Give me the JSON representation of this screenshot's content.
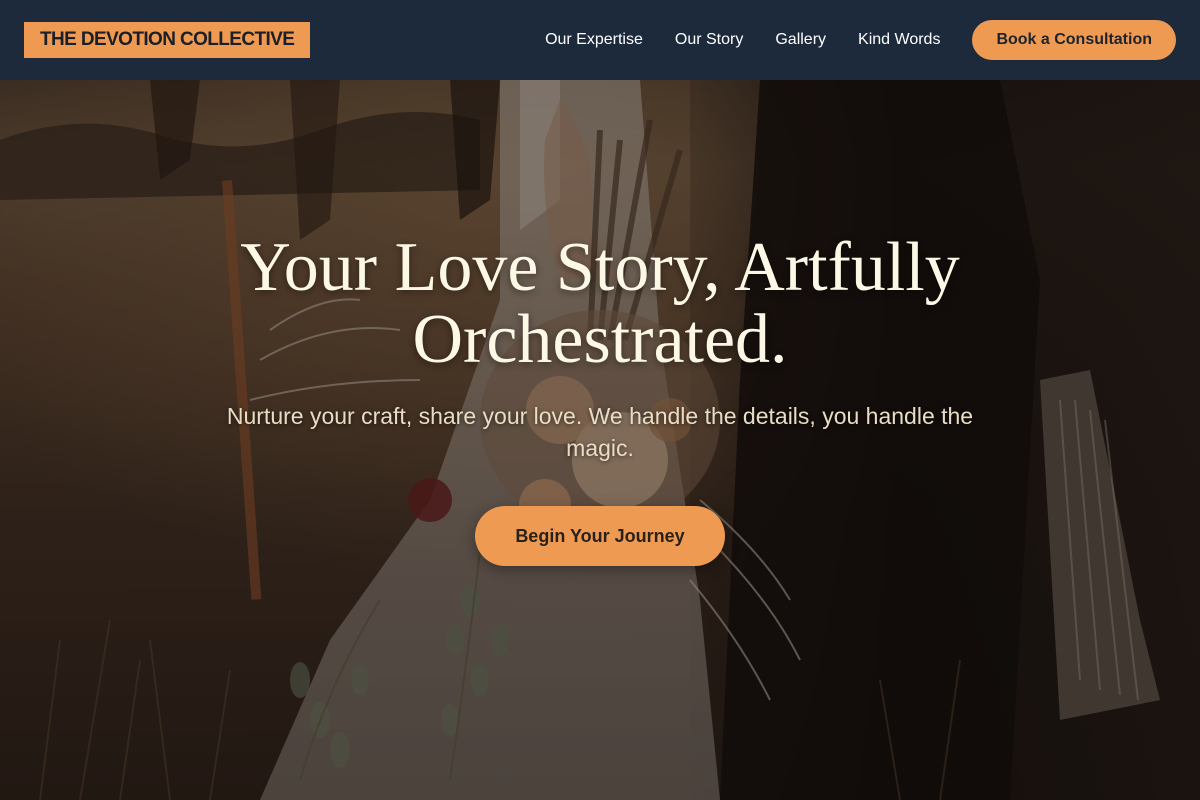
{
  "header": {
    "logo_text": "THE DEVOTION COLLECTIVE",
    "nav": [
      {
        "label": "Our Expertise"
      },
      {
        "label": "Our Story"
      },
      {
        "label": "Gallery"
      },
      {
        "label": "Kind Words"
      }
    ],
    "cta_label": "Book a Consultation"
  },
  "hero": {
    "title": "Your Love Story, Artfully Orchestrated.",
    "subtitle": "Nurture your craft, share your love. We handle the details, you handle the magic.",
    "button_label": "Begin Your Journey",
    "background": "wedding-bouquet-photo"
  },
  "colors": {
    "header_bg": "#1c2a3c",
    "accent": "#ee9a52",
    "hero_title": "#fdf8e6",
    "hero_subtitle": "#e8dcc4"
  }
}
